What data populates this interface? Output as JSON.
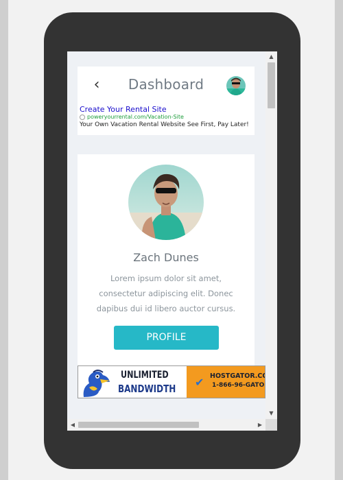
{
  "header": {
    "back_icon": "chevron-left-icon",
    "back_glyph": "‹",
    "title": "Dashboard"
  },
  "ad": {
    "title": "Create Your Rental Site",
    "url": "poweryourrental.com/Vacation-Site",
    "description": "Your Own Vacation Rental Website See First, Pay Later!"
  },
  "profile": {
    "name": "Zach Dunes",
    "bio": "Lorem ipsum dolor sit amet, consectetur adipiscing elit. Donec dapibus dui id libero auctor cursus.",
    "button_label": "PROFILE"
  },
  "banner": {
    "line1": "UNLIMITED",
    "line2": "BANDWIDTH",
    "site": "HOSTGATOR.CO",
    "phone": "1-866-96-GATO"
  },
  "colors": {
    "accent": "#26b8c7",
    "device": "#333333",
    "screen_bg": "#eef1f5",
    "ad_link": "#1a0dcc",
    "ad_url": "#1d9c3b",
    "banner_orange": "#f39a1f"
  },
  "scrollbar": {
    "up_glyph": "▲",
    "down_glyph": "▼",
    "left_glyph": "◀",
    "right_glyph": "▶"
  }
}
